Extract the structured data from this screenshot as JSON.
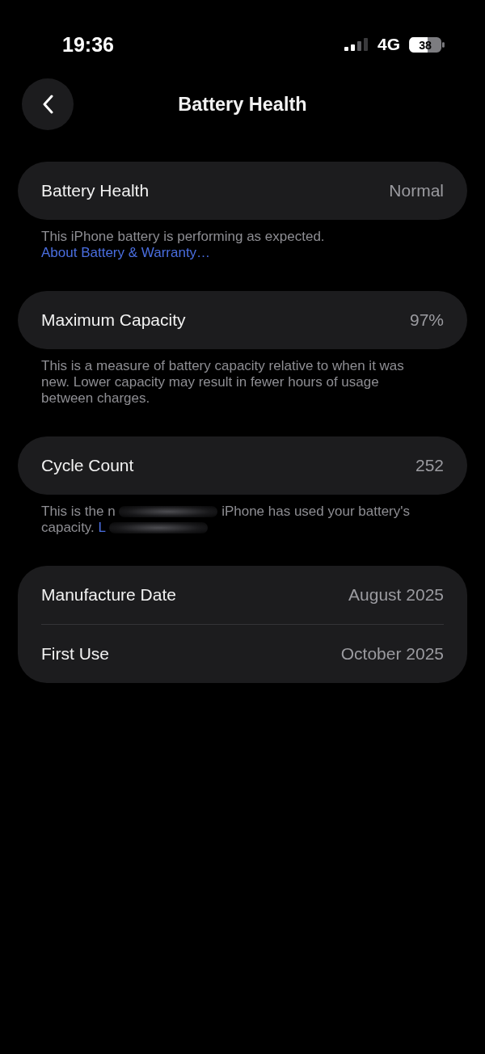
{
  "status_bar": {
    "time": "19:36",
    "network": "4G",
    "battery": "38"
  },
  "header": {
    "title": "Battery Health"
  },
  "sections": [
    {
      "rows": [
        {
          "label": "Battery Health",
          "value": "Normal"
        }
      ],
      "footnote": [
        {
          "kind": "text",
          "text": "This iPhone battery is performing as expected."
        },
        {
          "kind": "link",
          "text": "About Battery & Warranty…"
        }
      ]
    },
    {
      "rows": [
        {
          "label": "Maximum Capacity",
          "value": "97%"
        }
      ],
      "footnote": [
        {
          "kind": "text",
          "text": "This is a measure of battery capacity relative to when it was new. Lower capacity may result in fewer hours of usage between charges."
        }
      ]
    },
    {
      "rows": [
        {
          "label": "Cycle Count",
          "value": "252"
        }
      ],
      "footnote": [
        {
          "kind": "text",
          "text": "This is the n"
        },
        {
          "kind": "obscured"
        },
        {
          "kind": "text",
          "text": "iPhone has used your battery's capacity."
        },
        {
          "kind": "link",
          "text": "L"
        },
        {
          "kind": "obscured"
        }
      ]
    },
    {
      "rows": [
        {
          "label": "Manufacture Date",
          "value": "August 2025"
        },
        {
          "label": "First Use",
          "value": "October 2025"
        }
      ]
    }
  ]
}
